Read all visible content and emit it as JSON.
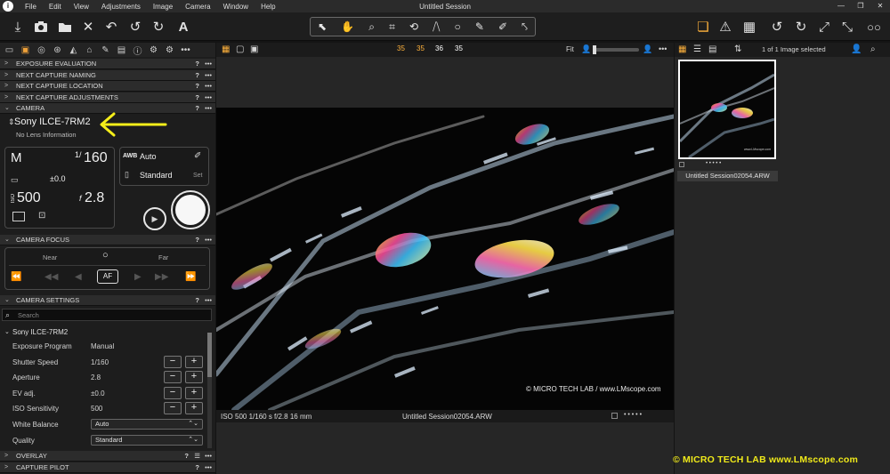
{
  "app": {
    "title": "Untitled Session"
  },
  "menu": [
    "File",
    "Edit",
    "View",
    "Adjustments",
    "Image",
    "Camera",
    "Window",
    "Help"
  ],
  "window_controls": [
    "—",
    "❐",
    "✕"
  ],
  "viewer_header": {
    "color_values": [
      "35",
      "35",
      "36",
      "35"
    ],
    "fit_label": "Fit"
  },
  "browser_header": {
    "selection_text": "1 of 1 Image selected"
  },
  "sections": {
    "exposure_evaluation": "EXPOSURE EVALUATION",
    "next_capture_naming": "NEXT CAPTURE NAMING",
    "next_capture_location": "NEXT CAPTURE LOCATION",
    "next_capture_adjustments": "NEXT CAPTURE ADJUSTMENTS",
    "camera": "CAMERA",
    "camera_focus": "CAMERA FOCUS",
    "camera_settings": "CAMERA SETTINGS",
    "overlay": "OVERLAY",
    "capture_pilot": "CAPTURE PILOT"
  },
  "section_help": "?",
  "section_more": "•••",
  "camera": {
    "model": "Sony ILCE-7RM2",
    "lens": "No Lens Information",
    "mode": "M",
    "shutter_num": "1/",
    "shutter_den": "160",
    "ev": "±0.0",
    "iso_label": "ISO",
    "iso": "500",
    "aperture_prefix": "f",
    "aperture": "2.8",
    "wb_badge": "AWB",
    "wb": "Auto",
    "quality": "Standard",
    "set_label": "Set"
  },
  "focus": {
    "near": "Near",
    "far": "Far",
    "af": "AF"
  },
  "camera_settings": {
    "search_placeholder": "Search",
    "device": "Sony ILCE-7RM2",
    "rows": [
      {
        "k": "Exposure Program",
        "v": "Manual"
      },
      {
        "k": "Shutter Speed",
        "v": "1/160"
      },
      {
        "k": "Aperture",
        "v": "2.8"
      },
      {
        "k": "EV adj.",
        "v": "±0.0"
      },
      {
        "k": "ISO Sensitivity",
        "v": "500"
      },
      {
        "k": "White Balance",
        "v": "Auto"
      },
      {
        "k": "Quality",
        "v": "Standard"
      }
    ]
  },
  "stepper": {
    "minus": "−",
    "plus": "+"
  },
  "viewer_status": {
    "info": "ISO 500 1/160 s f/2.8 16 mm",
    "filename": "Untitled Session02054.ARW"
  },
  "photo_caption": "© MICRO TECH LAB / www.LMscope.com",
  "thumbnail": {
    "caption": "Untitled Session02054.ARW",
    "stars": "• • • • •",
    "caption_small": "www.LMscope.com"
  },
  "watermark": "©  MICRO TECH LAB   www.LMscope.com",
  "colors": {
    "accent": "#ffb23c",
    "arrow": "#f5ee1a",
    "watermark": "#f0ea1a"
  }
}
